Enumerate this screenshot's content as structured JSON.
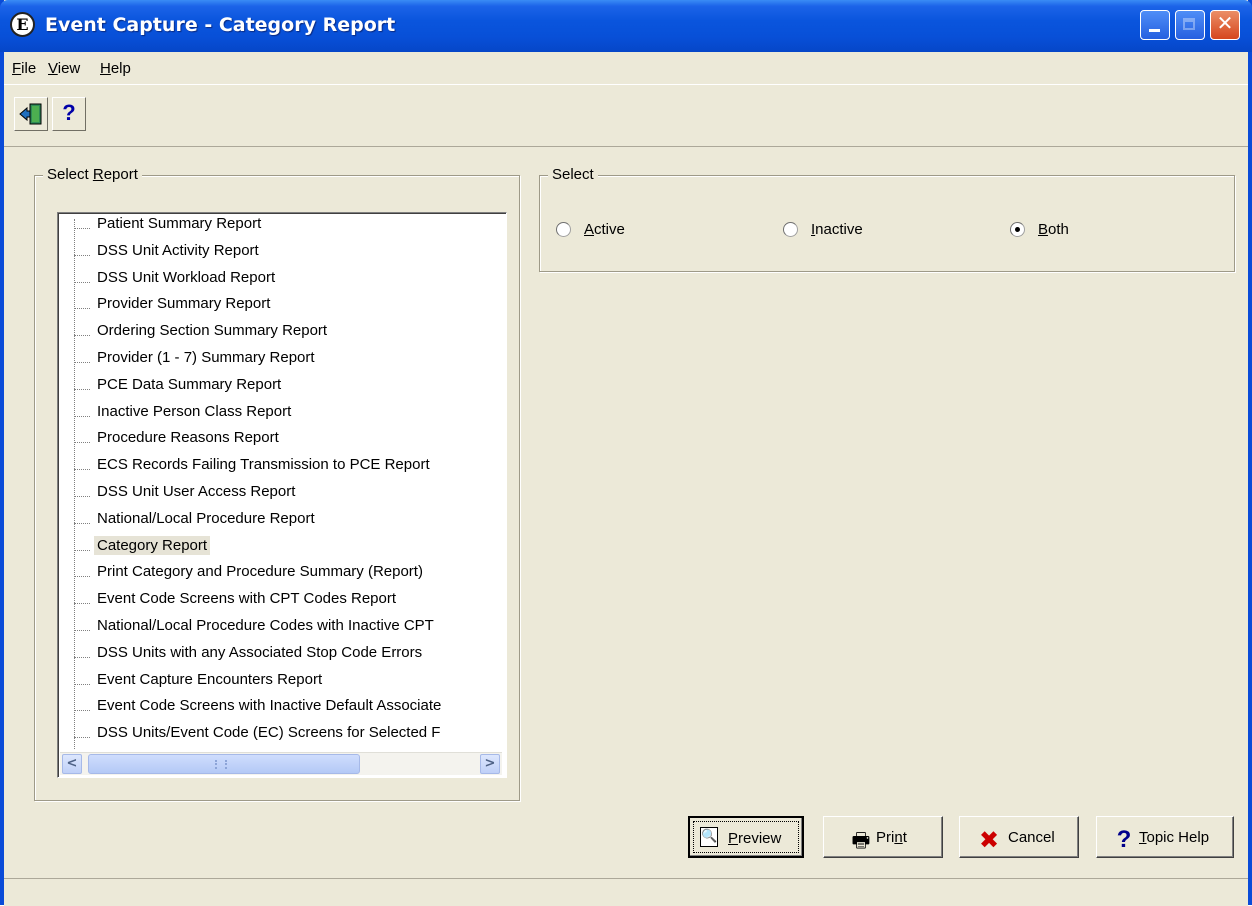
{
  "window": {
    "title": "Event Capture - Category Report",
    "app_icon": "event-capture-e-icon"
  },
  "menu": [
    {
      "pre": "",
      "key": "F",
      "post": "ile"
    },
    {
      "pre": "",
      "key": "V",
      "post": "iew"
    },
    {
      "pre": "",
      "key": "H",
      "post": "elp"
    }
  ],
  "toolbar": {
    "exit_icon": "exit-door-icon",
    "help_glyph": "?"
  },
  "report_group": {
    "label_pre": "Select ",
    "label_key": "R",
    "label_post": "eport",
    "items": [
      "Patient Summary Report",
      "DSS Unit Activity Report",
      "DSS Unit Workload Report",
      "Provider Summary Report",
      "Ordering Section Summary Report",
      "Provider (1 - 7) Summary Report",
      "PCE Data Summary Report",
      "Inactive Person Class Report",
      "Procedure Reasons Report",
      "ECS Records Failing Transmission to PCE Report",
      "DSS Unit User Access Report",
      "National/Local Procedure Report",
      "Category Report",
      "Print Category and Procedure Summary (Report)",
      "Event Code Screens with CPT Codes Report",
      "National/Local Procedure Codes with Inactive CPT",
      "DSS Units with any Associated Stop Code Errors",
      "Event Capture Encounters Report",
      "Event Code Screens with Inactive Default Associate",
      "DSS Units/Event Code (EC) Screens for Selected F"
    ],
    "selected": "Category Report",
    "scroll_left": "<",
    "scroll_right": ">"
  },
  "select_group": {
    "label": "Select",
    "options": [
      {
        "key": "A",
        "rest": "ctive",
        "checked": false
      },
      {
        "key": "I",
        "rest": "nactive",
        "checked": false
      },
      {
        "key": "B",
        "rest": "oth",
        "checked": true
      }
    ]
  },
  "buttons": {
    "preview": {
      "key": "P",
      "rest": "review"
    },
    "print": {
      "pre": "Pri",
      "key": "n",
      "post": "t"
    },
    "cancel": {
      "label": "Cancel"
    },
    "topic_help": {
      "key": "T",
      "rest": "opic Help"
    }
  },
  "colors": {
    "titlebar": "#0A55DD",
    "face": "#ECE9D8",
    "cancel_x": "#CC0000",
    "help_q": "#00008B"
  }
}
